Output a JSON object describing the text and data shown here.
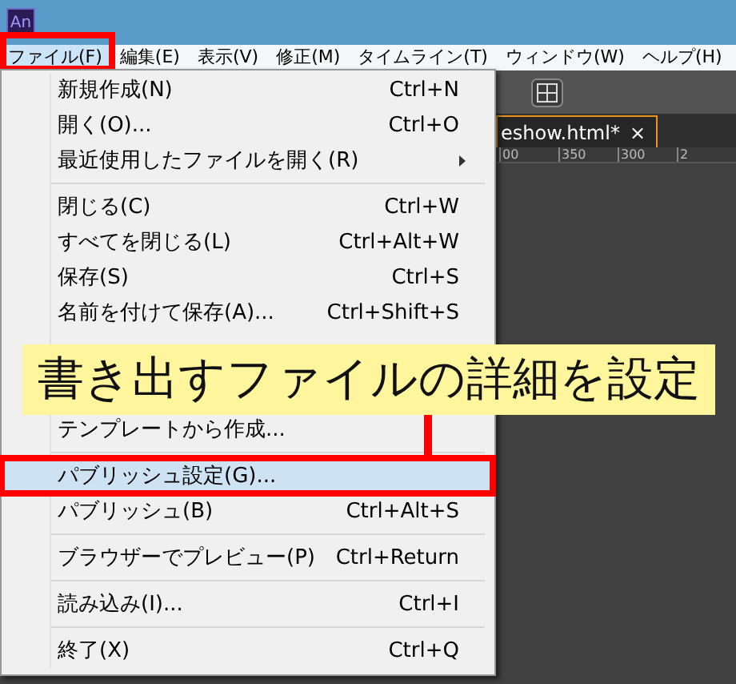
{
  "app_icon": {
    "label": "An"
  },
  "menu_bar": [
    {
      "label": "ファイル(F)",
      "selected": true,
      "outlined": true
    },
    {
      "label": "編集(E)",
      "selected": false,
      "outlined": false
    },
    {
      "label": "表示(V)",
      "selected": false,
      "outlined": false
    },
    {
      "label": "修正(M)",
      "selected": false,
      "outlined": false
    },
    {
      "label": "タイムライン(T)",
      "selected": false,
      "outlined": false
    },
    {
      "label": "ウィンドウ(W)",
      "selected": false,
      "outlined": false
    },
    {
      "label": "ヘルプ(H)",
      "selected": false,
      "outlined": false
    }
  ],
  "workspace": {
    "document_tab": "eshow.html*",
    "tab_close": "×",
    "ruler_labels": [
      "00",
      "350",
      "300",
      "2"
    ]
  },
  "file_menu": {
    "items": [
      {
        "kind": "item",
        "label": "新規作成(N)",
        "shortcut": "Ctrl+N",
        "submenu": false,
        "highlighted": false,
        "outlined": false
      },
      {
        "kind": "item",
        "label": "開く(O)...",
        "shortcut": "Ctrl+O",
        "submenu": false,
        "highlighted": false,
        "outlined": false
      },
      {
        "kind": "item",
        "label": "最近使用したファイルを開く(R)",
        "submenu": true,
        "highlighted": false,
        "outlined": false
      },
      {
        "kind": "separator"
      },
      {
        "kind": "item",
        "label": "閉じる(C)",
        "shortcut": "Ctrl+W",
        "submenu": false,
        "highlighted": false,
        "outlined": false
      },
      {
        "kind": "item",
        "label": "すべてを閉じる(L)",
        "shortcut": "Ctrl+Alt+W",
        "submenu": false,
        "highlighted": false,
        "outlined": false
      },
      {
        "kind": "item",
        "label": "保存(S)",
        "shortcut": "Ctrl+S",
        "submenu": false,
        "highlighted": false,
        "outlined": false
      },
      {
        "kind": "item",
        "label": "名前を付けて保存(A)...",
        "shortcut": "Ctrl+Shift+S",
        "submenu": false,
        "highlighted": false,
        "outlined": false
      },
      {
        "kind": "covered"
      },
      {
        "kind": "item",
        "label": "テンプレートから作成...",
        "submenu": false,
        "highlighted": false,
        "outlined": false
      },
      {
        "kind": "separator"
      },
      {
        "kind": "item",
        "label": "パブリッシュ設定(G)...",
        "submenu": false,
        "highlighted": true,
        "outlined": true
      },
      {
        "kind": "item",
        "label": "パブリッシュ(B)",
        "shortcut": "Ctrl+Alt+S",
        "submenu": false,
        "highlighted": false,
        "outlined": false
      },
      {
        "kind": "separator"
      },
      {
        "kind": "item",
        "label": "ブラウザーでプレビュー(P)",
        "shortcut": "Ctrl+Return",
        "submenu": false,
        "highlighted": false,
        "outlined": false
      },
      {
        "kind": "separator"
      },
      {
        "kind": "item",
        "label": "読み込み(I)...",
        "shortcut": "Ctrl+I",
        "submenu": false,
        "highlighted": false,
        "outlined": false
      },
      {
        "kind": "separator"
      },
      {
        "kind": "item",
        "label": "終了(X)",
        "shortcut": "Ctrl+Q",
        "submenu": false,
        "highlighted": false,
        "outlined": false
      }
    ]
  },
  "annotation": {
    "callout": "書き出すファイルの詳細を設定"
  }
}
